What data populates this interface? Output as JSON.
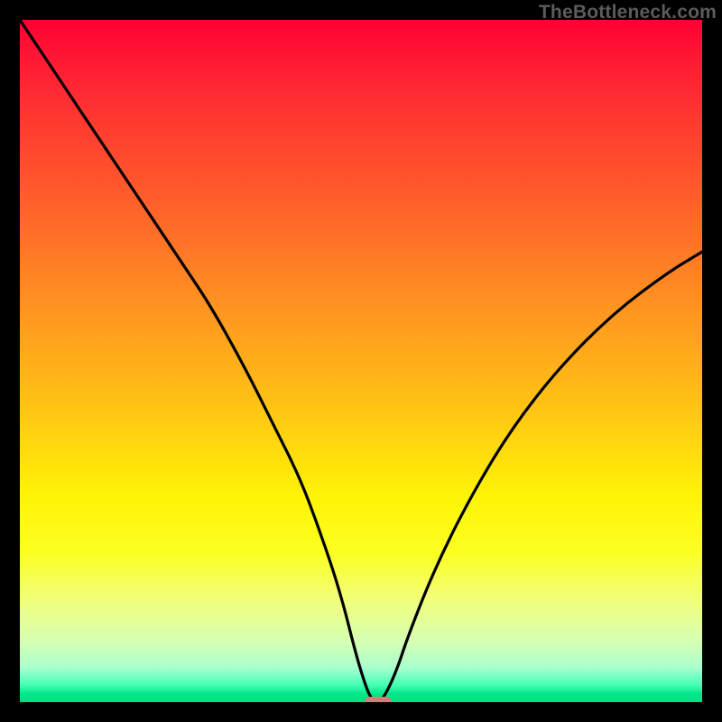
{
  "watermark": "TheBottleneck.com",
  "chart_data": {
    "type": "line",
    "title": "",
    "xlabel": "",
    "ylabel": "",
    "xlim": [
      0,
      100
    ],
    "ylim": [
      0,
      100
    ],
    "grid": false,
    "legend": false,
    "gradient_stops": [
      {
        "pct": 0,
        "color": "#ff0033"
      },
      {
        "pct": 6,
        "color": "#ff1a33"
      },
      {
        "pct": 16,
        "color": "#ff3d30"
      },
      {
        "pct": 30,
        "color": "#ff6a29"
      },
      {
        "pct": 44,
        "color": "#ff9a1f"
      },
      {
        "pct": 58,
        "color": "#ffc813"
      },
      {
        "pct": 70,
        "color": "#fff406"
      },
      {
        "pct": 78,
        "color": "#fbff21"
      },
      {
        "pct": 85,
        "color": "#f1ff7a"
      },
      {
        "pct": 91,
        "color": "#d7ffb3"
      },
      {
        "pct": 95,
        "color": "#a8ffce"
      },
      {
        "pct": 97.5,
        "color": "#45ffb6"
      },
      {
        "pct": 98.8,
        "color": "#00e787"
      },
      {
        "pct": 100,
        "color": "#00e081"
      }
    ],
    "series": [
      {
        "name": "bottleneck-curve",
        "x": [
          0,
          6,
          12,
          18,
          24,
          28,
          33,
          37,
          41,
          44,
          47,
          49.5,
          51.5,
          53,
          55,
          57,
          61,
          66,
          72,
          79,
          87,
          95,
          100
        ],
        "y": [
          100,
          91,
          82,
          73,
          64,
          58,
          49,
          41,
          33,
          25,
          16,
          6,
          0,
          0,
          4,
          10,
          20,
          30,
          40,
          49,
          57,
          63,
          66
        ]
      }
    ],
    "marker": {
      "x": 52.5,
      "y": 0,
      "width_pct": 4.0,
      "color": "#d87a77"
    }
  }
}
